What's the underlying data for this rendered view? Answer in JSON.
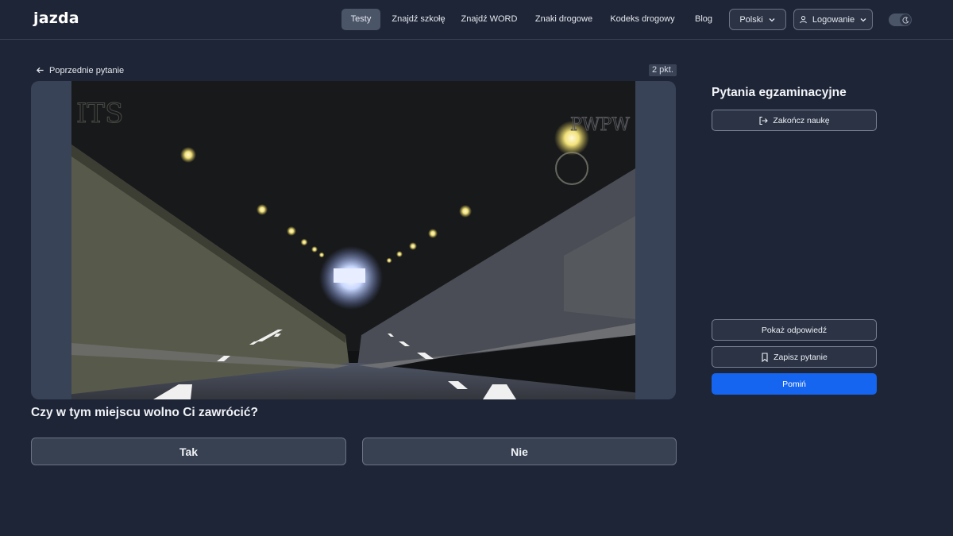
{
  "brand": {
    "logo": "jazda"
  },
  "nav": {
    "items": [
      {
        "label": "Testy",
        "active": true
      },
      {
        "label": "Znajdź szkołę"
      },
      {
        "label": "Znajdź WORD"
      },
      {
        "label": "Znaki drogowe"
      },
      {
        "label": "Kodeks drogowy"
      },
      {
        "label": "Blog"
      }
    ],
    "language": "Polski",
    "login": "Logowanie"
  },
  "question": {
    "back_label": "Poprzednie pytanie",
    "points": "2 pkt.",
    "text": "Czy w tym miejscu wolno Ci zawrócić?",
    "answers": [
      "Tak",
      "Nie"
    ],
    "watermarks": {
      "left": "ITS",
      "right": "PWPW"
    }
  },
  "panel": {
    "title": "Pytania egzaminacyjne",
    "finish_label": "Zakończ naukę",
    "show_answer_label": "Pokaż odpowiedź",
    "save_label": "Zapisz pytanie",
    "skip_label": "Pomiń"
  },
  "colors": {
    "background": "#1e2536",
    "accent": "#1565f0",
    "card": "#374151"
  }
}
